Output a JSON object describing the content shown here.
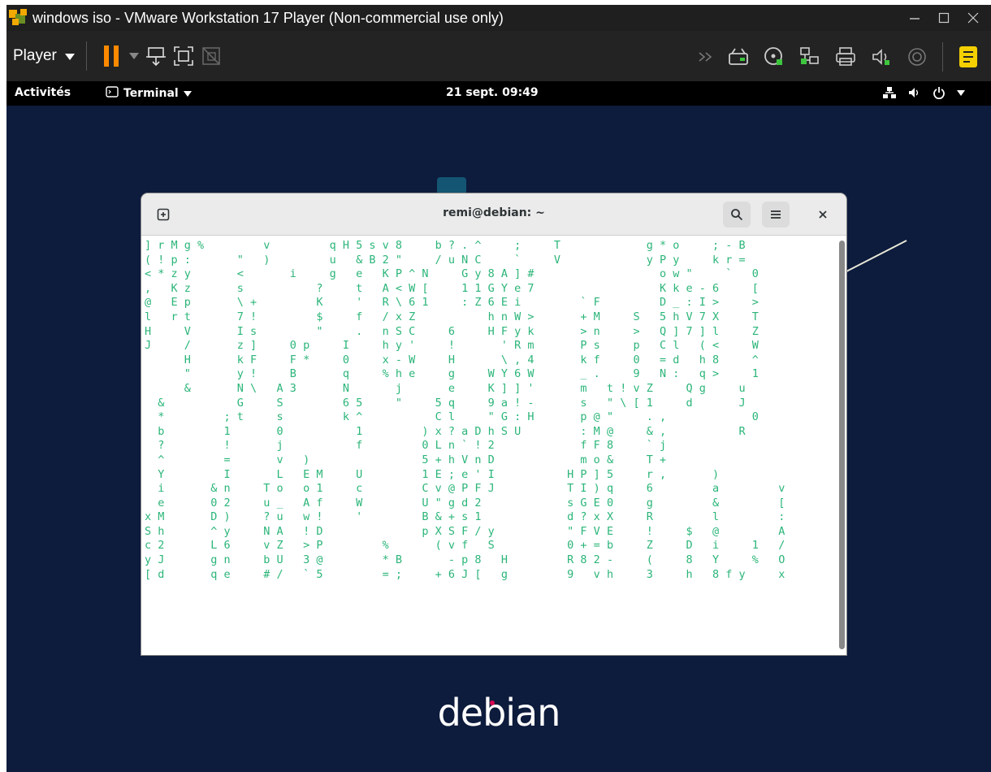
{
  "window": {
    "title": "windows iso - VMware Workstation 17 Player (Non-commercial use only)",
    "minimize_icon": "minimize-icon",
    "maximize_icon": "maximize-icon",
    "close_icon": "close-icon"
  },
  "toolbar": {
    "player_label": "Player",
    "accent_color": "#e8a000",
    "icons": [
      "pause-icon",
      "send-ctrl-alt-del-icon",
      "fullscreen-icon",
      "unity-icon",
      "hdd-icon",
      "cdrom-icon",
      "network-icon",
      "printer-icon",
      "sound-icon",
      "usb-icon",
      "message-log-icon"
    ]
  },
  "gnome": {
    "activities": "Activités",
    "app_menu": "Terminal",
    "clock": "21 sept. 09:49"
  },
  "terminal": {
    "title": "remi@debian: ~",
    "text_color": "#2bb579",
    "lines": [
      "] r M g %         v         q H 5 s v 8     b ? . ^     ;     T             g * o     ; - B",
      "( ! p :       \"   )         u   & B 2 \"     / u N C     `     V             y P y     k r =",
      "< * z y       <       i     g   e   K P ^ N     G y 8 A ] #                   o w \"     `   0",
      ",   K z       s           ?     t   A < W [     1 1 G Y e 7                   K k e - 6     [",
      "@   E p       \\ +         K     '   R \\ 6 1     : Z 6 E i         ` F         D _ : I >     >",
      "l   r t       7 !         $     f   / x Z           h n W >       + M     S   5 h V 7 X     T",
      "H     V       I s         \"     .   n S C     6     H F y k       > n     >   Q ] 7 ] l     Z",
      "J     /       z ]     0 p     I     h y '     !       ' R m       P s     p   C l   ( <     W",
      "      H       k F     F *     0     x - W     H       \\ , 4       k f     0   = d   h 8     ^",
      "      \"       y !     B       q     % h e     g     W Y 6 W       _ .     9   N :   q >     1",
      "      &       N \\   A 3       N       j       e     K ] ] '       m   t ! v Z     Q g     u",
      "  &           G     S         6 5     \"     5 q     9 a ! -       s   \" \\ [ 1     d       J",
      "  *         ; t     s         k ^           C l     \" G : H       p @ \"     . ,             0",
      "  b         1       0           1         ) x ? a D h S U         : M @     & ,           R",
      "  ?         !       j           f         0 L n ` ! 2             f F 8     ` j",
      "  ^         =       v   )                 5 + h V n D             m o &     T +",
      "  Y         I       L   E M     U         1 E ; e ' I           H P ] 5     r ,       )",
      "  i       & n     T o   o 1     c         C v @ P F J           T I ) q     6         a         v",
      "  e       0 2     u _   A f     W         U \" g d 2             s G E 0     g         &         [",
      "x M       D )     ? u   w !     '         B & + s 1             d ? x X     R         l         :",
      "S h       ^ y     N A   ! D               p X S F / y           \" F V E     !     $   @         A",
      "c 2       L 6     v Z   > P         %       ( v f   S           0 + = b     Z     D   i     1   /",
      "y J       g n     b U   3 @         * B       - p 8   H         R 8 2 -     (     8   Y     %   O",
      "[ d       q e     # /   ` 5         = ;     + 6 J [   g         9   v h     3     h   8 f y     x"
    ]
  },
  "desktop": {
    "brand": "debian",
    "background_color": "#0d1b3c"
  }
}
